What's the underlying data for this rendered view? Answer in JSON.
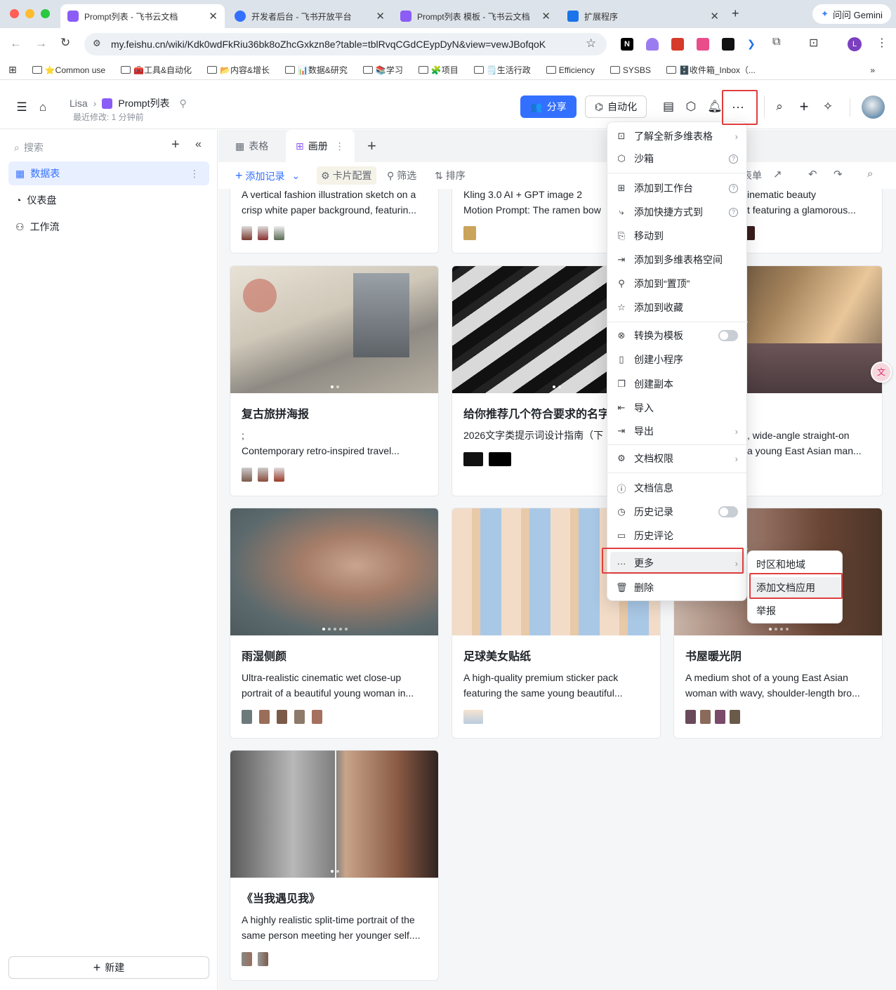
{
  "browser": {
    "tabs": [
      {
        "title": "Prompt列表 - 飞书云文档",
        "icon_color": "#8b5cf6"
      },
      {
        "title": "开发者后台 - 飞书开放平台",
        "icon_color": "#3370ff"
      },
      {
        "title": "Prompt列表 模板 - 飞书云文档",
        "icon_color": "#8b5cf6"
      },
      {
        "title": "扩展程序",
        "icon_color": "#1a73e8"
      }
    ],
    "gemini_label": "问问 Gemini",
    "url": "my.feishu.cn/wiki/Kdk0wdFkRiu36bk8oZhcGxkzn8e?table=tblRvqCGdCEypDyN&view=vewJBofqoK",
    "profile_initial": "L",
    "bookmarks": [
      "⭐Common use",
      "🧰工具&自动化",
      "📂内容&增长",
      "📊数据&研究",
      "📚学习",
      "🧩项目",
      "🗒️生活行政",
      "Efficiency",
      "SYSBS",
      "🗄️收件箱_Inbox（..."
    ]
  },
  "header": {
    "breadcrumb_parent": "Lisa",
    "doc_title": "Prompt列表",
    "last_modified": "最近修改: 1 分钟前",
    "share_label": "分享",
    "automation_label": "自动化"
  },
  "sidebar": {
    "search_placeholder": "搜索",
    "items": [
      {
        "label": "数据表",
        "icon": "table-icon"
      },
      {
        "label": "仪表盘",
        "icon": "dashboard-icon"
      },
      {
        "label": "工作流",
        "icon": "workflow-icon"
      }
    ],
    "new_label": "新建"
  },
  "views": {
    "tabs": [
      {
        "label": "表格",
        "icon": "grid-table-icon"
      },
      {
        "label": "画册",
        "icon": "gallery-icon"
      }
    ]
  },
  "actions": {
    "add_record": "添加记录",
    "card_config": "卡片配置",
    "filter": "筛选",
    "sort": "排序",
    "form_partial": "表单"
  },
  "cards": [
    {
      "title": "",
      "desc": "A vertical fashion illustration sketch on a crisp white paper background, featurin..."
    },
    {
      "title": "",
      "desc": "Kling 3.0 AI + GPT image 2\nMotion Prompt: The ramen bow"
    },
    {
      "title": "",
      "desc": "inematic beauty\nt featuring a glamorous..."
    },
    {
      "title": "复古旅拼海报",
      "desc": ";\nContemporary retro-inspired travel..."
    },
    {
      "title": "给你推荐几个符合要求的名字",
      "desc": "2026文字类提示词设计指南（下"
    },
    {
      "title": "",
      "desc": ", wide-angle straight-on\na young East Asian man..."
    },
    {
      "title": "雨湿侧颜",
      "desc": "Ultra-realistic cinematic wet close-up portrait of a beautiful young woman in..."
    },
    {
      "title": "足球美女贴纸",
      "desc": "A high-quality premium sticker pack featuring the same young beautiful..."
    },
    {
      "title": "书屋暖光阴",
      "desc": "A medium shot of a young East Asian woman with wavy, shoulder-length bro..."
    },
    {
      "title": "《当我遇见我》",
      "desc": "A highly realistic split-time portrait of the same person meeting her younger self...."
    }
  ],
  "menu": {
    "items": [
      {
        "label": "了解全新多维表格",
        "icon": "info-card-icon",
        "suffix": "arrow"
      },
      {
        "label": "沙箱",
        "icon": "cube-icon",
        "suffix": "help"
      },
      {
        "label": "添加到工作台",
        "icon": "apps-icon",
        "suffix": "help"
      },
      {
        "label": "添加快捷方式到",
        "icon": "shortcut-icon",
        "suffix": "help"
      },
      {
        "label": "移动到",
        "icon": "move-icon",
        "suffix": ""
      },
      {
        "label": "添加到多维表格空间",
        "icon": "space-icon",
        "suffix": ""
      },
      {
        "label": "添加到“置顶”",
        "icon": "pin-icon",
        "suffix": ""
      },
      {
        "label": "添加到收藏",
        "icon": "star-icon",
        "suffix": ""
      },
      {
        "label": "转换为模板",
        "icon": "template-icon",
        "suffix": "toggle"
      },
      {
        "label": "创建小程序",
        "icon": "phone-icon",
        "suffix": ""
      },
      {
        "label": "创建副本",
        "icon": "copy-icon",
        "suffix": ""
      },
      {
        "label": "导入",
        "icon": "import-icon",
        "suffix": ""
      },
      {
        "label": "导出",
        "icon": "export-icon",
        "suffix": "arrow"
      },
      {
        "label": "文档权限",
        "icon": "settings-icon",
        "suffix": "arrow"
      },
      {
        "label": "文档信息",
        "icon": "info-icon",
        "suffix": ""
      },
      {
        "label": "历史记录",
        "icon": "history-icon",
        "suffix": "toggle"
      },
      {
        "label": "历史评论",
        "icon": "comment-icon",
        "suffix": ""
      },
      {
        "label": "更多",
        "icon": "more-icon",
        "suffix": "arrow"
      },
      {
        "label": "删除",
        "icon": "trash-icon",
        "suffix": ""
      }
    ]
  },
  "submenu": {
    "items": [
      "时区和地域",
      "添加文档应用",
      "举报"
    ]
  },
  "colors": {
    "accent": "#3370ff",
    "highlight": "#e03e3e",
    "sidebar_active": "#e8efff"
  }
}
